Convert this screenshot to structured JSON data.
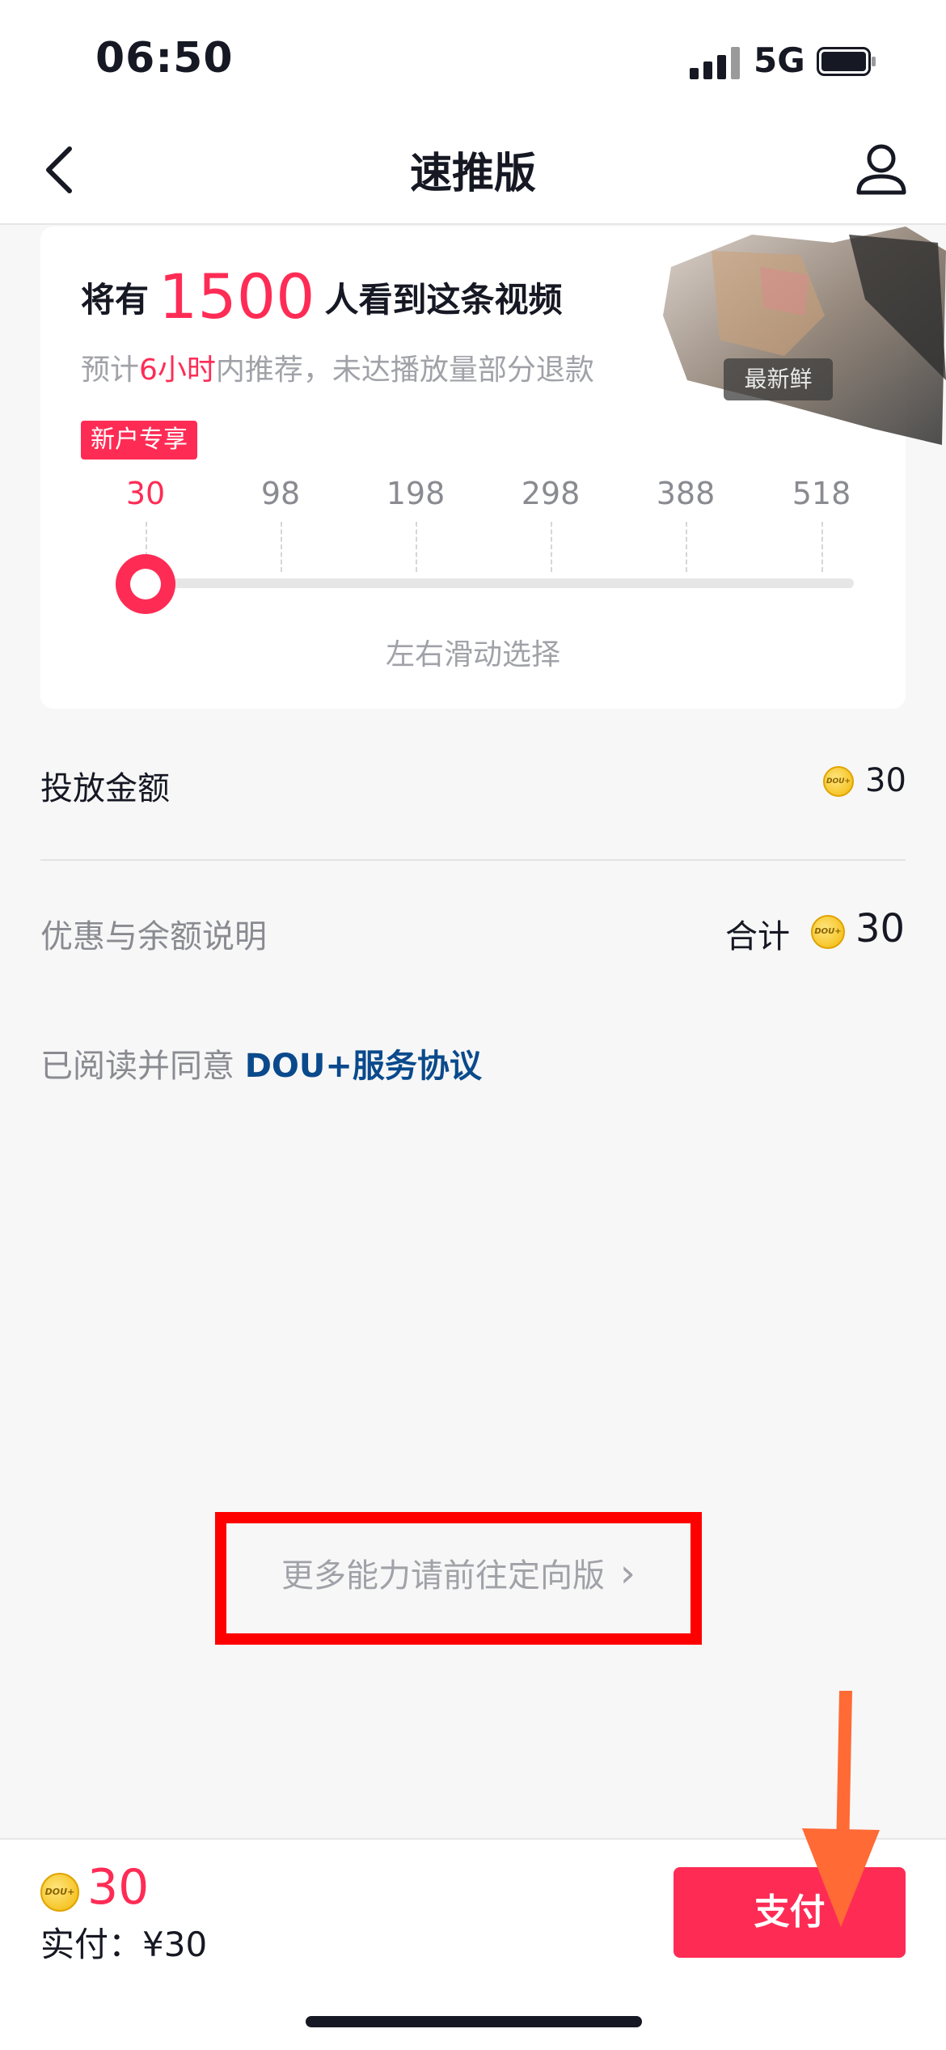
{
  "status_bar": {
    "time": "06:50",
    "network": "5G"
  },
  "nav": {
    "title": "速推版"
  },
  "card": {
    "headline_prefix": "将有",
    "headline_number": "1500",
    "headline_suffix": "人看到这条视频",
    "sub_prefix": "预计",
    "sub_highlight": "6小时",
    "sub_suffix": "内推荐，未达播放量部分退款",
    "badge": "新户专享",
    "thumbnail_tag": "最新鲜",
    "options": [
      "30",
      "98",
      "198",
      "298",
      "388",
      "518"
    ],
    "selected_option": "30",
    "slider_hint": "左右滑动选择"
  },
  "amount_row": {
    "label": "投放金额",
    "value": "30"
  },
  "discount_row": {
    "label": "优惠与余额说明",
    "total_label": "合计",
    "value": "30"
  },
  "agreement": {
    "prefix": "已阅读并同意 ",
    "link": "DOU+服务协议"
  },
  "more_link": {
    "label": "更多能力请前往定向版",
    "chevron": "›"
  },
  "bottom_bar": {
    "coin_label": "DOU+",
    "amount": "30",
    "paid_label": "实付：",
    "paid_value": "¥30",
    "pay_button": "支付"
  },
  "colors": {
    "accent": "#fe2c55",
    "link": "#0a4a8c",
    "annotation_box": "#ff0000",
    "annotation_arrow": "#ff6a35"
  },
  "icons": [
    "back-arrow-icon",
    "user-icon",
    "signal-icon",
    "battery-icon",
    "coin-icon",
    "chevron-right-icon"
  ]
}
